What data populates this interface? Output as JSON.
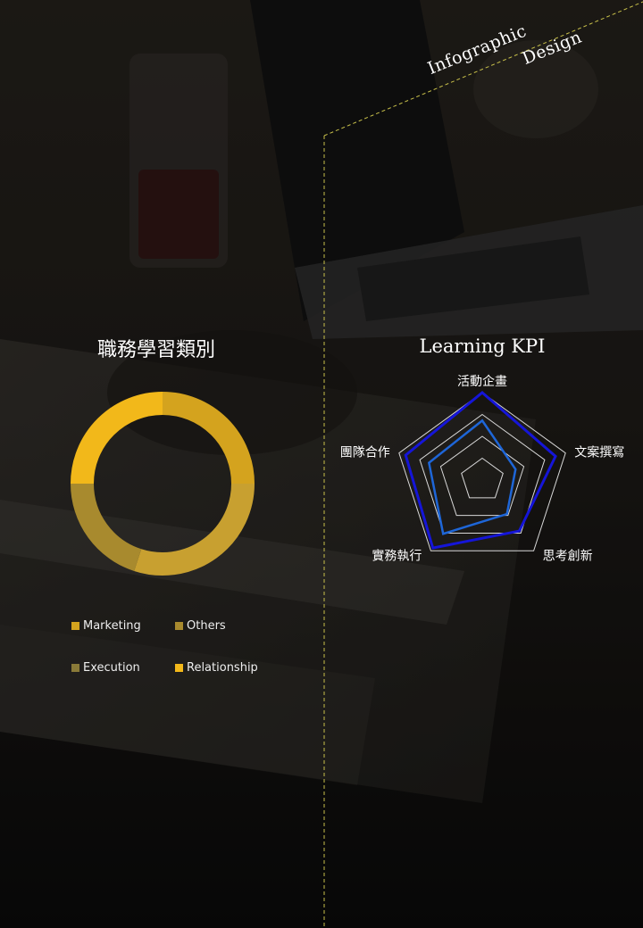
{
  "header": {
    "word1": "Infographic",
    "word2": "Design"
  },
  "donut": {
    "title": "職務學習類別",
    "legend": [
      {
        "label": "Marketing",
        "color": "#d4a31e"
      },
      {
        "label": "Others",
        "color": "#a88a2e"
      },
      {
        "label": "Execution",
        "color": "#8a7a38"
      },
      {
        "label": "Relationship",
        "color": "#f2b81a"
      }
    ]
  },
  "chart_data": [
    {
      "type": "pie",
      "title": "職務學習類別",
      "categories": [
        "Marketing",
        "Others",
        "Execution",
        "Relationship"
      ],
      "values": [
        25,
        30,
        20,
        25
      ],
      "colors": [
        "#d4a31e",
        "#c8a030",
        "#a88a2e",
        "#f2b81a"
      ]
    },
    {
      "type": "radar",
      "title": "Learning KPI",
      "categories": [
        "活動企畫",
        "文案撰寫",
        "思考創新",
        "實務執行",
        "團隊合作"
      ],
      "range": [
        0,
        5
      ],
      "grid_levels": 4,
      "series": [
        {
          "values": [
            5.0,
            4.4,
            3.6,
            4.8,
            4.6
          ],
          "color": "#1515d8"
        },
        {
          "values": [
            3.4,
            2.0,
            2.4,
            3.8,
            3.2
          ],
          "color": "#1e66d8"
        }
      ]
    }
  ]
}
